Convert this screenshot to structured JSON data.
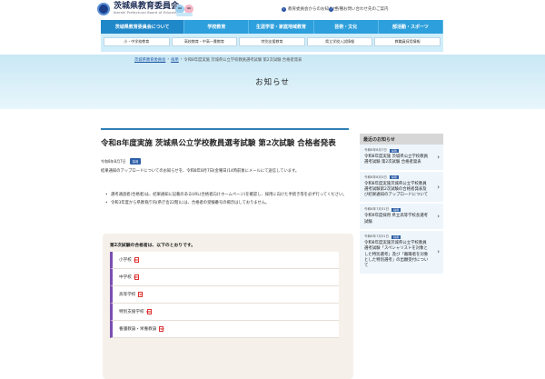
{
  "header": {
    "logo_title": "茨城県教育委員会",
    "logo_subtitle": "Ibaraki Prefectural Board of Education",
    "util_links": [
      "教育委員会からのお知らせ",
      "各種お問い合わせ先のご案内"
    ]
  },
  "nav": [
    "茨城県教育委員会について",
    "学校教育",
    "生涯学習・家庭地域教育",
    "芸術・文化",
    "部活動・スポーツ"
  ],
  "subnav": [
    "小・中学校教育",
    "高校教育・中高一貫教育",
    "特別支援教育",
    "県立学校入試情報",
    "教職員採用情報"
  ],
  "breadcrumb": [
    "茨城県教育委員会",
    "採用",
    "令和8年度実施 茨城県公立学校教員選考試験 第2次試験 合格者発表"
  ],
  "page_heading": "お知らせ",
  "article": {
    "title": "令和8年度実施 茨城県公立学校教員選考試験 第2次試験 合格者発表",
    "date": "令和8年8月7日",
    "badge": "採用",
    "body": "結果通知のアップロードについてのお知らせを、令和8年8月7日(金曜日)14時前後にメールにて送信しています。",
    "notes": [
      "選考通過者(合格者)は、結果通知に記載のあるURL(合格者向けホームページ)を確認し、採用に向けた手続き等を必ず行ってください。",
      "令和3年度から県教育庁内(県庁舎22階)には、合格者の受験番号の掲示はしておりません。"
    ]
  },
  "results": {
    "title": "第2次試験の合格者は、以下のとおりです。",
    "items": [
      "小学校",
      "中学校",
      "高等学校",
      "特別支援学校",
      "養護教諭・栄養教諭"
    ],
    "pdf_label": "PDF"
  },
  "sidebar": {
    "title": "最近のお知らせ",
    "items": [
      {
        "date": "令和8年8月7日",
        "badge": "採用",
        "text": "令和8年度実施 茨城県公立学校教員選考試験 第2次試験 合格者発表"
      },
      {
        "date": "令和8年8月3日",
        "badge": "採用",
        "text": "令和8年度実施茨城県公立学校教員選考試験第2次試験の合格者発表及び結果通知のアップロードについて"
      },
      {
        "date": "令和8年7月31日",
        "badge": "採用",
        "text": "令和9年度採用 県立高等学校長選考試験"
      },
      {
        "date": "令和8年7月31日",
        "badge": "採用",
        "text": "令和8年度実施茨城県公立学校教員選考試験「スペシャリストを対象とした特別選考」及び「離職者を対象とした特別選考」の出願受付について"
      }
    ]
  },
  "colors": {
    "nav": "#2d9fdc",
    "accent": "#2d5fa8",
    "result_border": "#7b4fb0"
  }
}
